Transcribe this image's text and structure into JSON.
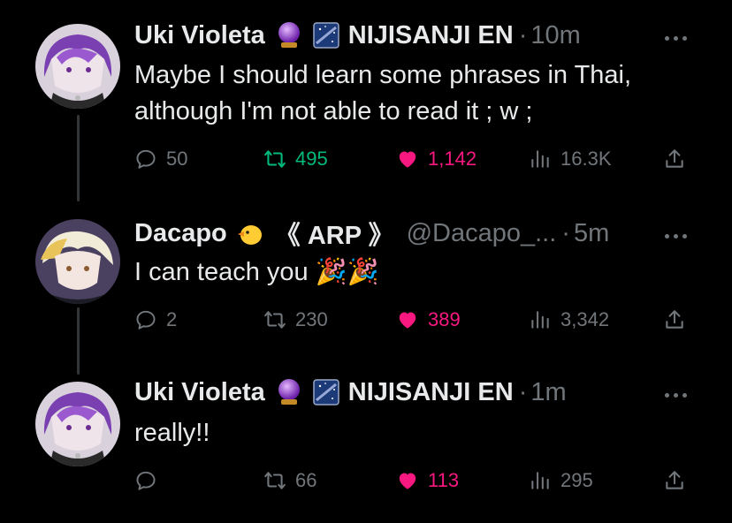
{
  "tweets": [
    {
      "name": "Uki Violeta",
      "org": "NIJISANJI EN",
      "handle": "",
      "time": "10m",
      "text": "Maybe I should learn some phrases in Thai,\nalthough I'm not able to read it ; w ;",
      "replies": "50",
      "retweets": "495",
      "likes": "1,142",
      "views": "16.3K",
      "retweeted": true,
      "liked": true,
      "emojis": [
        "crystal-ball-icon",
        "night-sky-icon"
      ]
    },
    {
      "name": "Dacapo",
      "org": "《 ARP 》",
      "handle": "@Dacapo_...",
      "time": "5m",
      "text": "I can teach you 🎉🎉",
      "replies": "2",
      "retweets": "230",
      "likes": "389",
      "views": "3,342",
      "retweeted": false,
      "liked": true,
      "emojis": [
        "chick-icon"
      ]
    },
    {
      "name": "Uki Violeta",
      "org": "NIJISANJI EN",
      "handle": "",
      "time": "1m",
      "text": "really!!",
      "replies": "",
      "retweets": "66",
      "likes": "113",
      "views": "295",
      "retweeted": false,
      "liked": true,
      "emojis": [
        "crystal-ball-icon",
        "night-sky-icon"
      ]
    }
  ],
  "colors": {
    "background": "#000000",
    "text": "#e7e9ea",
    "muted": "#71767b",
    "retweet": "#00ba7c",
    "like": "#f91880",
    "thread_line": "#333639"
  }
}
